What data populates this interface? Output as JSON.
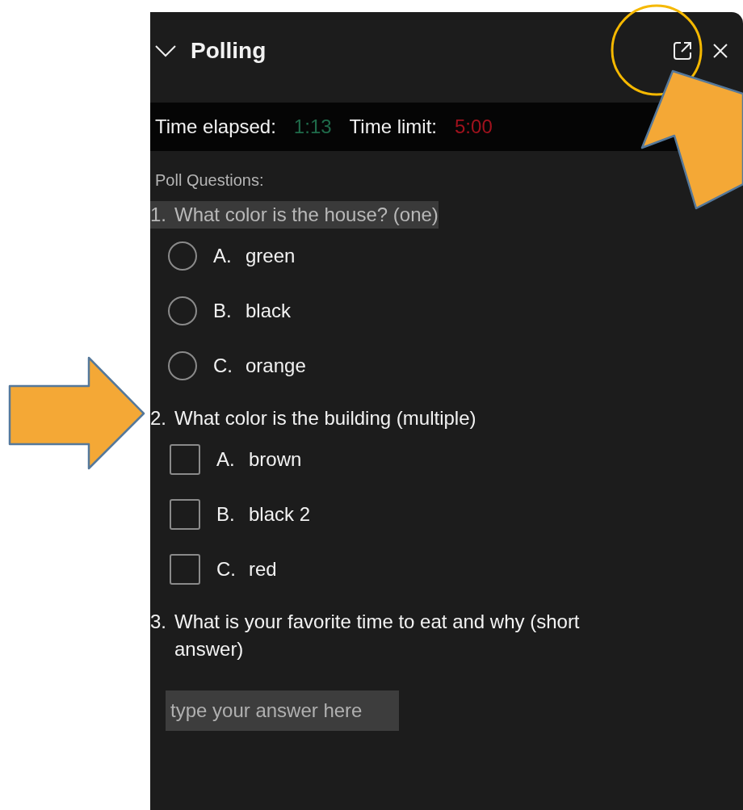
{
  "panel": {
    "title": "Polling"
  },
  "timer": {
    "elapsed_label": "Time elapsed:",
    "elapsed": "1:13",
    "limit_label": "Time limit:",
    "limit": "5:00"
  },
  "section_label": "Poll Questions:",
  "questions": [
    {
      "kind": "single",
      "number": "1.",
      "text": "What color is the house? (one)",
      "highlighted": true,
      "options": [
        {
          "letter": "A.",
          "label": "green",
          "selected": false
        },
        {
          "letter": "B.",
          "label": "black",
          "selected": false
        },
        {
          "letter": "C.",
          "label": "orange",
          "selected": false
        }
      ]
    },
    {
      "kind": "multiple",
      "number": "2.",
      "text": "What color is the building (multiple)",
      "highlighted": false,
      "options": [
        {
          "letter": "A.",
          "label": "brown",
          "checked": false
        },
        {
          "letter": "B.",
          "label": "black 2",
          "checked": false
        },
        {
          "letter": "C.",
          "label": "red",
          "checked": false
        }
      ]
    },
    {
      "kind": "text",
      "number": "3.",
      "text": "What is your favorite time to eat and why (short answer)",
      "highlighted": false,
      "placeholder": "type your answer here"
    }
  ],
  "annotations": [
    {
      "kind": "circle"
    },
    {
      "kind": "arrow"
    },
    {
      "kind": "arrow"
    }
  ]
}
